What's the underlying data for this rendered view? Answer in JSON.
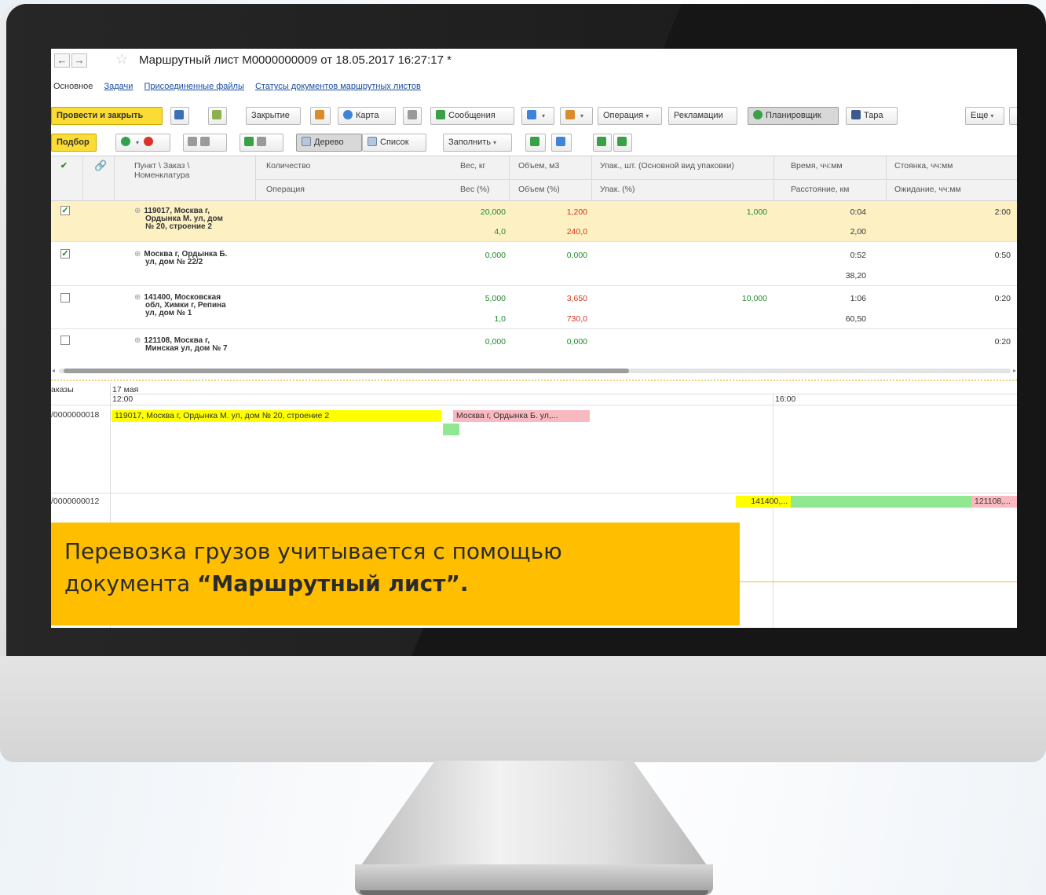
{
  "window": {
    "title": "Маршрутный лист М0000000009 от 18.05.2017 16:27:17 *",
    "back_glyph": "←",
    "forward_glyph": "→",
    "star_glyph": "☆"
  },
  "tabs": [
    {
      "label": "Основное",
      "active": true
    },
    {
      "label": "Задачи"
    },
    {
      "label": "Присоединенные файлы"
    },
    {
      "label": "Статусы документов маршрутных листов"
    }
  ],
  "toolbar1": {
    "post_close": "Провести и закрыть",
    "closing": "Закрытие",
    "map": "Карта",
    "messages": "Сообщения",
    "operation": "Операция",
    "claims": "Рекламации",
    "planner": "Планировщик",
    "tare": "Тара",
    "more": "Еще",
    "dropdown_glyph": "▾"
  },
  "toolbar2": {
    "pick": "Подбор",
    "tree": "Дерево",
    "list": "Список",
    "fill": "Заполнить"
  },
  "table": {
    "headers": {
      "check": "✔",
      "point_line1": "Пункт \\ Заказ \\",
      "point_line2": "Номенклатура",
      "quantity": "Количество",
      "operation": "Операция",
      "weight": "Вес, кг",
      "weight_pct": "Вес (%)",
      "volume": "Объем, м3",
      "volume_pct": "Объем (%)",
      "pack": "Упак., шт. (Основной вид упаковки)",
      "pack_pct": "Упак. (%)",
      "time": "Время, чч:мм",
      "distance": "Расстояние, км",
      "parking": "Стоянка, чч:мм",
      "waiting": "Ожидание, чч:мм"
    },
    "rows": [
      {
        "checked": "✓",
        "addr1": "119017, Москва г,",
        "addr2": "Ордынка М. ул, дом",
        "addr3": "№ 20, строение 2",
        "weight": "20,000",
        "weight_pct": "4,0",
        "volume": "1,200",
        "volume_pct": "240,0",
        "pack": "1,000",
        "time": "0:04",
        "distance": "2,00",
        "parking": "2:00"
      },
      {
        "checked": "✓",
        "addr1": "Москва г, Ордынка Б.",
        "addr2": "ул, дом № 22/2",
        "addr3": "",
        "weight": "0,000",
        "weight_pct": "",
        "volume": "0,000",
        "volume_pct": "",
        "pack": "",
        "time": "0:52",
        "distance": "38,20",
        "parking": "0:50"
      },
      {
        "checked": "",
        "addr1": "141400, Московская",
        "addr2": "обл, Химки г, Репина",
        "addr3": "ул, дом № 1",
        "weight": "5,000",
        "weight_pct": "1,0",
        "volume": "3,650",
        "volume_pct": "730,0",
        "pack": "10,000",
        "time": "1:06",
        "distance": "60,50",
        "parking": "0:20"
      },
      {
        "checked": "",
        "addr1": "121108, Москва г,",
        "addr2": "Минская ул, дом № 7",
        "addr3": "",
        "weight": "0,000",
        "weight_pct": "",
        "volume": "0,000",
        "volume_pct": "",
        "pack": "",
        "time": "",
        "distance": "",
        "parking": "0:20"
      }
    ],
    "expand_glyph": "⊕"
  },
  "planner": {
    "col_label": "аказы",
    "date": "17 мая",
    "time1": "12:00",
    "time2": "16:00",
    "row1_id": "/0000000018",
    "row1_bar1": "119017, Москва г, Ордынка М. ул, дом № 20, строение 2",
    "row1_bar2": "Москва г, Ордынка Б. ул,...",
    "row2_id": "/0000000012",
    "row2_bar1": "141400,...",
    "row2_bar3": "121108,..."
  },
  "callout": {
    "line1": "Перевозка грузов учитывается с помощью",
    "line2_prefix": "документа ",
    "line2_bold": "“Маршрутный лист”."
  }
}
